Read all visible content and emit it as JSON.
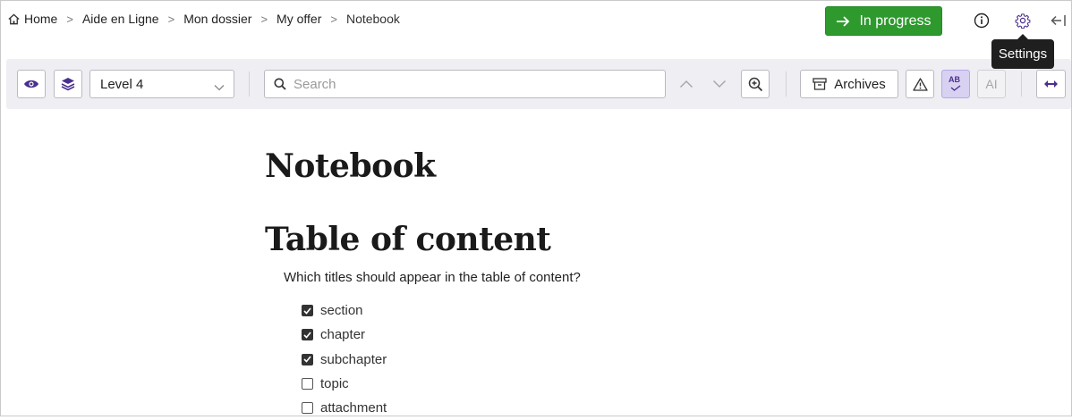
{
  "breadcrumb": {
    "items": [
      {
        "label": "Home",
        "icon": "home-icon"
      },
      {
        "label": "Aide en Ligne"
      },
      {
        "label": "Mon dossier"
      },
      {
        "label": "My offer"
      },
      {
        "label": "Notebook"
      }
    ],
    "separator": ">"
  },
  "header": {
    "status_label": "In progress",
    "status_color": "#2e9a2e",
    "status_icon": "arrow-right-icon",
    "info_icon": "info-icon",
    "settings_icon": "gear-icon",
    "collapse_icon": "arrow-left-bar-icon",
    "tooltip": "Settings"
  },
  "toolbar": {
    "visibility_icon": "eye-icon",
    "layers_icon": "layers-icon",
    "level_select": "Level 4",
    "search_placeholder": "Search",
    "search_value": "",
    "prev_icon": "chevron-up-icon",
    "next_icon": "chevron-down-icon",
    "zoom_icon": "zoom-in-icon",
    "archives_label": "Archives",
    "archives_icon": "archive-box-icon",
    "warning_icon": "warning-icon",
    "spellcheck_label": "AB",
    "ai_label": "AI",
    "expand_icon": "arrows-horizontal-icon",
    "accent_color": "#4b2f8f"
  },
  "document": {
    "title": "Notebook",
    "toc_title": "Table of content",
    "toc_question": "Which titles should appear in the table of content?",
    "toc_options": [
      {
        "label": "section",
        "checked": true
      },
      {
        "label": "chapter",
        "checked": true
      },
      {
        "label": "subchapter",
        "checked": true
      },
      {
        "label": "topic",
        "checked": false
      },
      {
        "label": "attachment",
        "checked": false
      }
    ]
  }
}
